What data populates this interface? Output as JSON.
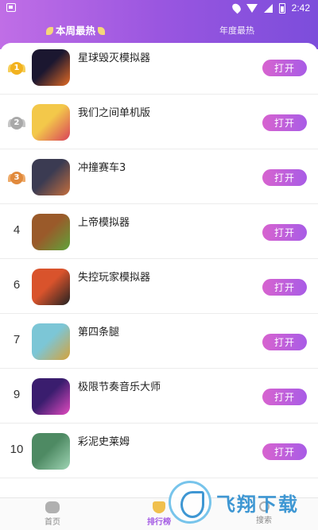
{
  "status_bar": {
    "time": "2:42"
  },
  "tabs": {
    "weekly": "本周最热",
    "yearly": "年度最热"
  },
  "list": [
    {
      "rank": "1",
      "medal": "gold",
      "name": "星球毁灭模拟器",
      "button": "打开",
      "icon_colors": [
        "#1b1730",
        "#e46b24"
      ]
    },
    {
      "rank": "2",
      "medal": "silver",
      "name": "我们之间单机版",
      "button": "打开",
      "icon_colors": [
        "#f3c84a",
        "#d9425a"
      ]
    },
    {
      "rank": "3",
      "medal": "bronze",
      "name": "冲撞赛车3",
      "button": "打开",
      "icon_colors": [
        "#3b3b52",
        "#c66f3d"
      ]
    },
    {
      "rank": "4",
      "medal": "",
      "name": "上帝模拟器",
      "button": "打开",
      "icon_colors": [
        "#9a5a2a",
        "#5fa33a"
      ]
    },
    {
      "rank": "6",
      "medal": "",
      "name": "失控玩家模拟器",
      "button": "打开",
      "icon_colors": [
        "#d9532c",
        "#222222"
      ]
    },
    {
      "rank": "7",
      "medal": "",
      "name": "第四条腿",
      "button": "打开",
      "icon_colors": [
        "#7cc6d6",
        "#d6a23a"
      ]
    },
    {
      "rank": "9",
      "medal": "",
      "name": "极限节奏音乐大师",
      "button": "打开",
      "icon_colors": [
        "#3a1d6e",
        "#e24ac0"
      ]
    },
    {
      "rank": "10",
      "medal": "",
      "name": "彩泥史莱姆",
      "button": "打开",
      "icon_colors": [
        "#4e8a63",
        "#9fd4b4"
      ]
    }
  ],
  "bottom_nav": {
    "home": "首页",
    "rank": "排行榜",
    "search": "搜索"
  },
  "watermark": {
    "text": "飞翔下载"
  }
}
